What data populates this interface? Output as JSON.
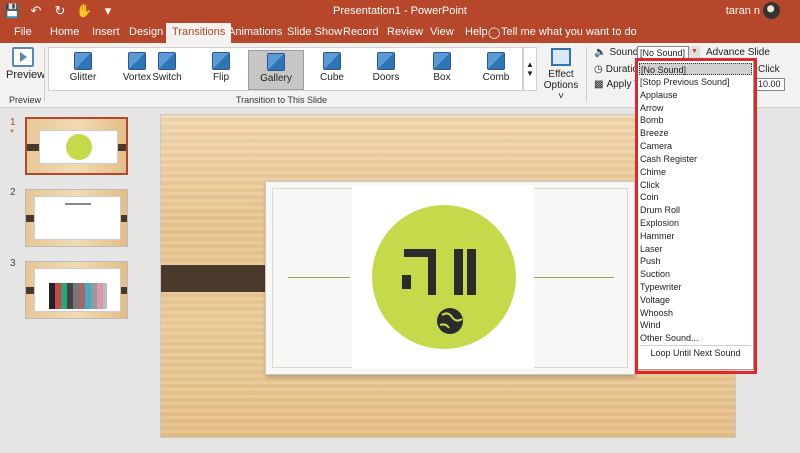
{
  "window": {
    "title": "Presentation1 - PowerPoint",
    "user": "taran n"
  },
  "tabs": [
    {
      "label": "File"
    },
    {
      "label": "Home"
    },
    {
      "label": "Insert"
    },
    {
      "label": "Design"
    },
    {
      "label": "Transitions",
      "active": true
    },
    {
      "label": "Animations"
    },
    {
      "label": "Slide Show"
    },
    {
      "label": "Record"
    },
    {
      "label": "Review"
    },
    {
      "label": "View"
    },
    {
      "label": "Help"
    }
  ],
  "tell_me": "Tell me what you want to do",
  "ribbon": {
    "preview": {
      "label": "Preview",
      "group_label": "Preview"
    },
    "transitions": [
      {
        "label": "Glitter",
        "icon": "glitter-icon"
      },
      {
        "label": "Vortex",
        "icon": "vortex-icon"
      },
      {
        "label": "Switch",
        "icon": "switch-icon"
      },
      {
        "label": "Flip",
        "icon": "flip-icon"
      },
      {
        "label": "Gallery",
        "icon": "gallery-icon",
        "selected": true
      },
      {
        "label": "Cube",
        "icon": "cube-icon"
      },
      {
        "label": "Doors",
        "icon": "doors-icon"
      },
      {
        "label": "Box",
        "icon": "box-icon"
      },
      {
        "label": "Comb",
        "icon": "comb-icon"
      }
    ],
    "transitions_group_label": "Transition to This Slide",
    "effect_options": {
      "line1": "Effect",
      "line2": "Options"
    },
    "timing": {
      "sound_label": "Sound:",
      "sound_value": "[No Sound]",
      "duration_label": "Duration",
      "apply_label": "Apply T",
      "advance_label": "Advance Slide",
      "on_click_label": "Click",
      "after_value": "10.00"
    }
  },
  "slides": [
    {
      "number": "1",
      "star": "*",
      "active": true
    },
    {
      "number": "2"
    },
    {
      "number": "3"
    }
  ],
  "sound_dropdown": {
    "items": [
      "[No Sound]",
      "[Stop Previous Sound]",
      "Applause",
      "Arrow",
      "Bomb",
      "Breeze",
      "Camera",
      "Cash Register",
      "Chime",
      "Click",
      "Coin",
      "Drum Roll",
      "Explosion",
      "Hammer",
      "Laser",
      "Push",
      "Suction",
      "Typewriter",
      "Voltage",
      "Whoosh",
      "Wind",
      "Other Sound..."
    ],
    "selected_index": 0,
    "loop_label": "Loop Until Next Sound"
  },
  "colors": {
    "accent": "#b7472a",
    "highlight": "#e0262f",
    "logo_circle": "#c6d94a"
  }
}
